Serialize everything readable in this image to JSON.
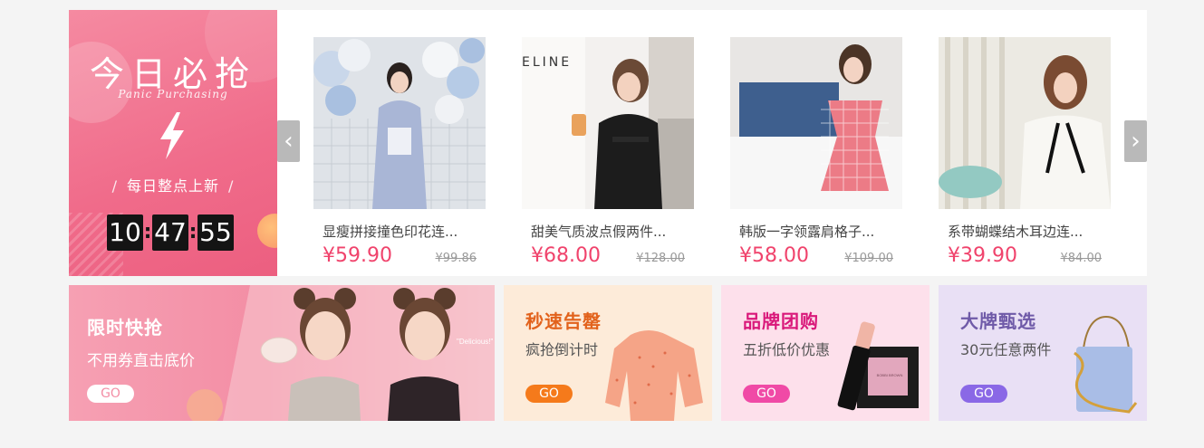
{
  "panic": {
    "title": "今日必抢",
    "subtitle": "Panic Purchasing",
    "slash_left": "/",
    "daily": "每日整点上新",
    "slash_right": "/",
    "timer": {
      "hours": "10",
      "minutes": "47",
      "seconds": "55",
      "sep": ":"
    }
  },
  "carousel": {
    "prev_icon": "‹",
    "next_icon": "›",
    "products": [
      {
        "name": "显瘦拼接撞色印花连...",
        "price": "¥59.90",
        "old_price": "¥99.86"
      },
      {
        "name": "甜美气质波点假两件...",
        "price": "¥68.00",
        "old_price": "¥128.00"
      },
      {
        "name": "韩版一字领露肩格子...",
        "price": "¥58.00",
        "old_price": "¥109.00"
      },
      {
        "name": "系带蝴蝶结木耳边连...",
        "price": "¥39.90",
        "old_price": "¥84.00"
      }
    ]
  },
  "banners": [
    {
      "title": "限时快抢",
      "subtitle": "不用券直击底价",
      "go": "GO",
      "tag": "\"Delicious!\""
    },
    {
      "title": "秒速告罄",
      "subtitle": "疯抢倒计时",
      "go": "GO"
    },
    {
      "title": "品牌团购",
      "subtitle": "五折低价优惠",
      "go": "GO",
      "brand_text": "BOBBI BROWN"
    },
    {
      "title": "大牌甄选",
      "subtitle": "30元任意两件",
      "go": "GO"
    }
  ],
  "colors": {
    "accent": "#f0436c",
    "panic_bg": "#f06b8a"
  }
}
